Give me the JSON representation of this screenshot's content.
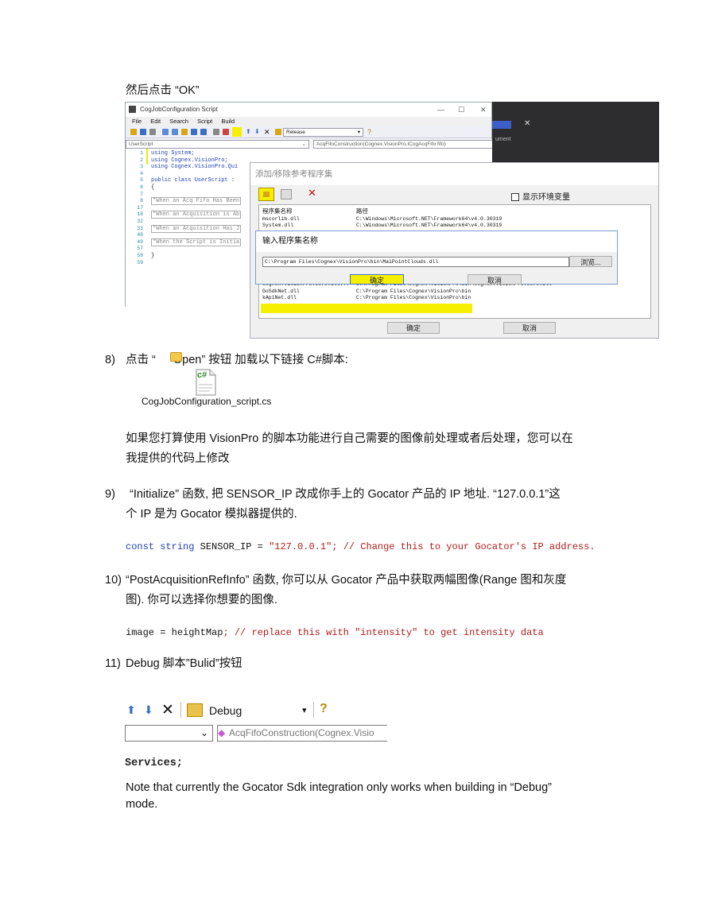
{
  "step_then": "然后点击 “OK”",
  "shot1": {
    "window_title": "CogJobConfiguration Script",
    "menu": [
      "File",
      "Edit",
      "Search",
      "Script",
      "Build"
    ],
    "build_config": "Release",
    "class_combo": "UserScript",
    "method_combo": "AcqFifoConstruction(Cognex.VisionPro.ICogAcqFifo fifo)",
    "line_numbers": [
      "1",
      "2",
      "3",
      "4",
      "5",
      "6",
      "7",
      "8",
      "17",
      "18",
      "32",
      "33",
      "48",
      "49",
      "57",
      "58",
      "59"
    ],
    "code_lines": [
      "using System;",
      "using Cognex.VisionPro;",
      "using Cognex.VisionPro.Qui",
      "",
      "public class UserScript : ",
      "{",
      "",
      "\"When an Acq Fifo Has Been",
      "",
      "\"When an Acquisition is Ab",
      "",
      "\"When an Acquisition Has J",
      "",
      "\"When the Script is Initia",
      "",
      "}",
      ""
    ],
    "dark_panel_text": "ument",
    "dialog1_title": "添加/移除参考程序集",
    "dialog1_checkbox": "显示环境变量",
    "dialog1_col1": "程序集名称",
    "dialog1_col2": "路径",
    "dialog1_rows": [
      {
        "name": "mscorlib.dll",
        "path": "C:\\Windows\\Microsoft.NET\\Framework64\\v4.0.30319"
      },
      {
        "name": "System.dll",
        "path": "C:\\Windows\\Microsoft.NET\\Framework64\\v4.0.30319"
      },
      {
        "name": "Cognex.VisionPro.Core.dll...",
        "path": "C:\\Program Files\\Cognex\\VisionPro\\bin\\Cognex.VisionPro.Core.dll"
      },
      {
        "name": "GoSdkNet.dll",
        "path": "C:\\Program Files\\Cognex\\VisionPro\\bin"
      },
      {
        "name": "kApiNet.dll",
        "path": "C:\\Program Files\\Cognex\\VisionPro\\bin"
      }
    ],
    "dialog1_ok": "确定",
    "dialog1_cancel": "取消",
    "dialog2_title": "输入程序集名称",
    "dialog2_input": "C:\\Program Files\\Cognex\\VisionPro\\bin\\MaiPointClouds.dll",
    "dialog2_browse": "浏览...",
    "dialog2_ok": "确定",
    "dialog2_cancel": "取消"
  },
  "step8": {
    "num": "8)",
    "pre": "点击 “",
    "open": "Open",
    "post": "” 按钮 加载以下链接 C#脚本:"
  },
  "file_icon_label": "c#",
  "file_name": "CogJobConfiguration_script.cs",
  "para_modify_1": "如果您打算使用 VisionPro 的脚本功能进行自己需要的图像前处理或者后处理，您可以在",
  "para_modify_2": "我提供的代码上修改",
  "step9": {
    "num": "9)",
    "line1": "“Initialize” 函数, 把   SENSOR_IP  改成你手上的 Gocator 产品的 IP 地址. “127.0.0.1”这",
    "line2": "个 IP 是为 Gocator  模拟器提供的."
  },
  "code1": {
    "kw1": "const",
    "kw2": "string",
    "ident": "SENSOR_IP",
    "eq": "=",
    "str": "\"127.0.0.1\"",
    "semi": ";",
    "comment": "// Change this to your Gocator's IP address."
  },
  "step10": {
    "num": "10)",
    "line1": "“PostAcquisitionRefInfo” 函数, 你可以从 Gocator 产品中获取两幅图像(Range 图和灰度",
    "line2": "图). 你可以选择你想要的图像."
  },
  "code2": {
    "ident1": "image",
    "eq": "=",
    "ident2": "heightMap",
    "semi": ";",
    "comment": "// replace this with \"intensity\" to get intensity data"
  },
  "step11": {
    "num": "11)",
    "text": "Debug  脚本”Bulid”按钮"
  },
  "shot2": {
    "build_config": "Debug",
    "method_combo": "AcqFifoConstruction(Cognex.Visio",
    "services_text": "Services;"
  },
  "note_line1": "Note that currently the Gocator Sdk integration only works when building in “Debug”",
  "note_line2": "mode.",
  "colors": {
    "highlight": "#f6f000",
    "keyword": "#1f3fb0",
    "string": "#b31b1b",
    "comment": "#2e7d32"
  }
}
